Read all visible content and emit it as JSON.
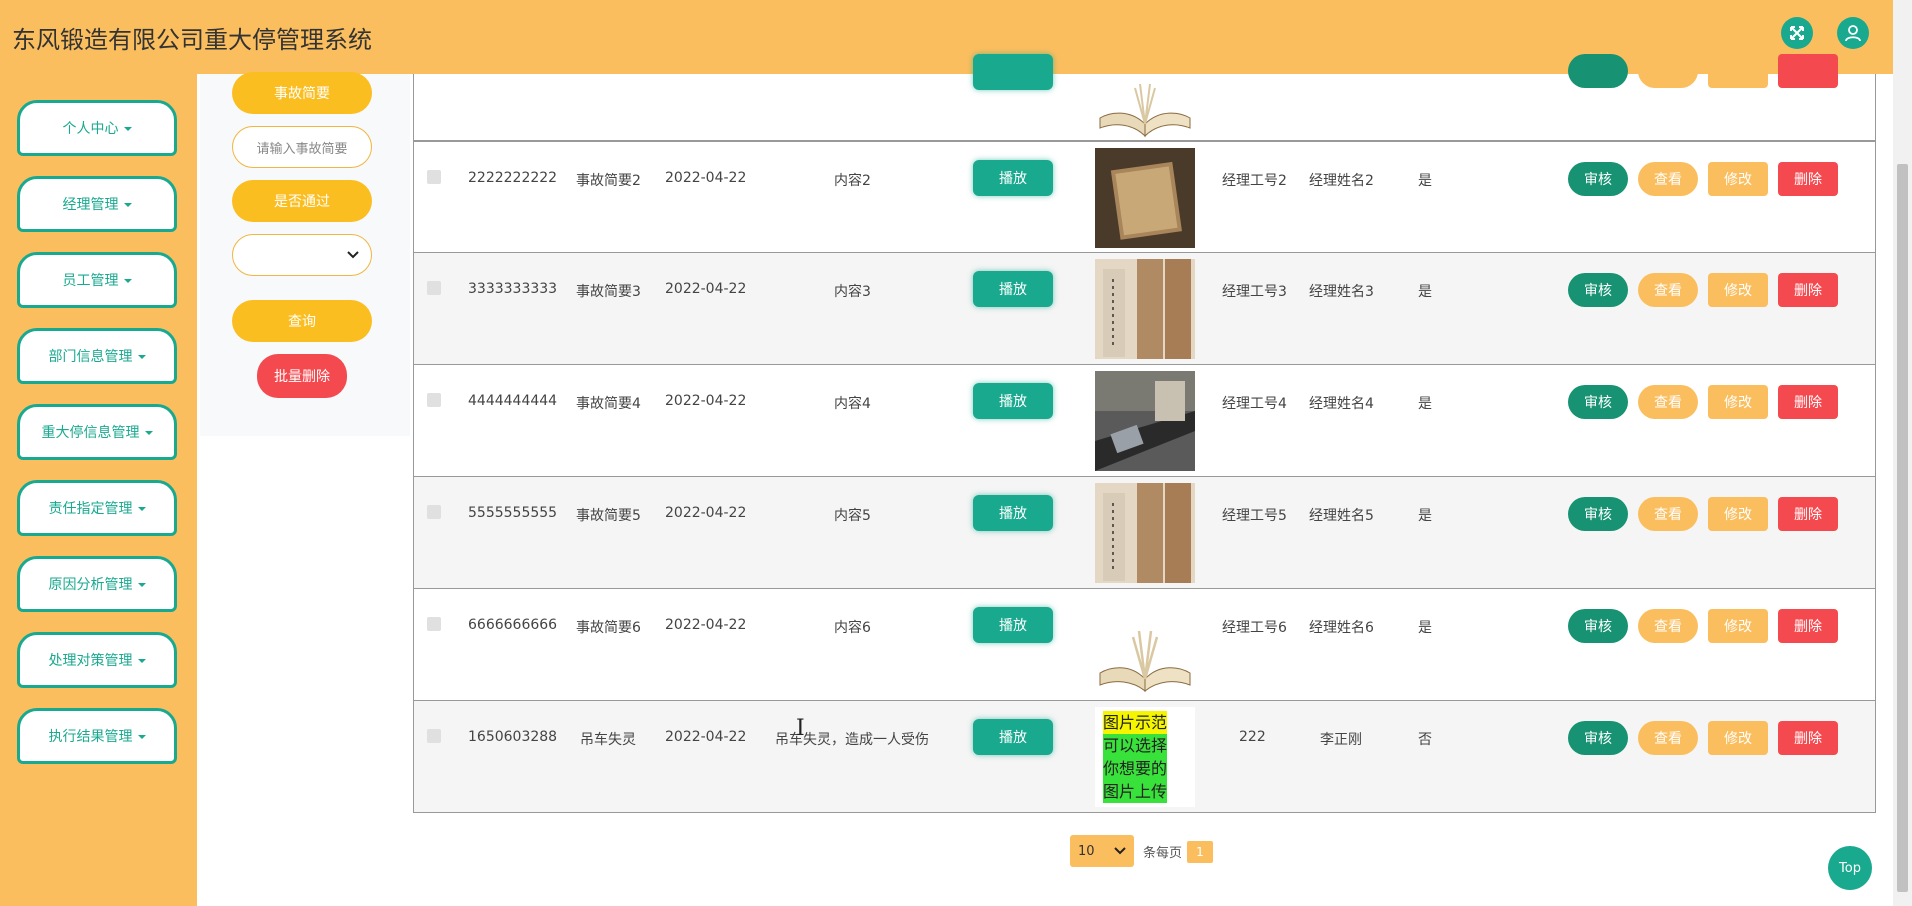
{
  "header": {
    "title": "东风锻造有限公司重大停管理系统"
  },
  "sidebar": {
    "items": [
      {
        "label": "个人中心"
      },
      {
        "label": "经理管理"
      },
      {
        "label": "员工管理"
      },
      {
        "label": "部门信息管理"
      },
      {
        "label": "重大停信息管理"
      },
      {
        "label": "责任指定管理"
      },
      {
        "label": "原因分析管理"
      },
      {
        "label": "处理对策管理"
      },
      {
        "label": "执行结果管理"
      }
    ]
  },
  "search": {
    "summary_label": "事故简要",
    "summary_placeholder": "请输入事故简要",
    "passed_label": "是否通过",
    "query_label": "查询",
    "batch_delete_label": "批量删除"
  },
  "table": {
    "play_label": "播放",
    "actions": {
      "review": "审核",
      "view": "查看",
      "edit": "修改",
      "delete": "删除"
    },
    "rows": [
      {
        "id": "2222222222",
        "summary": "事故简要2",
        "date": "2022-04-22",
        "content": "内容2",
        "image": "old-book",
        "manager_no": "经理工号2",
        "manager_name": "经理姓名2",
        "passed": "是"
      },
      {
        "id": "3333333333",
        "summary": "事故简要3",
        "date": "2022-04-22",
        "content": "内容3",
        "image": "scrolls",
        "manager_no": "经理工号3",
        "manager_name": "经理姓名3",
        "passed": "是"
      },
      {
        "id": "4444444444",
        "summary": "事故简要4",
        "date": "2022-04-22",
        "content": "内容4",
        "image": "library",
        "manager_no": "经理工号4",
        "manager_name": "经理姓名4",
        "passed": "是"
      },
      {
        "id": "5555555555",
        "summary": "事故简要5",
        "date": "2022-04-22",
        "content": "内容5",
        "image": "scrolls",
        "manager_no": "经理工号5",
        "manager_name": "经理姓名5",
        "passed": "是"
      },
      {
        "id": "6666666666",
        "summary": "事故简要6",
        "date": "2022-04-22",
        "content": "内容6",
        "image": "open-book",
        "manager_no": "经理工号6",
        "manager_name": "经理姓名6",
        "passed": "是"
      },
      {
        "id": "1650603288",
        "summary": "吊车失灵",
        "date": "2022-04-22",
        "content": "吊车失灵，造成一人受伤",
        "image": "sample-text",
        "manager_no": "222",
        "manager_name": "李正刚",
        "passed": "否"
      }
    ],
    "sample_image_lines": [
      "图片示范",
      "可以选择",
      "你想要的",
      "图片上传"
    ]
  },
  "pagination": {
    "page_size": "10",
    "per_page_label": "条每页",
    "current_page": "1"
  },
  "top_button": "Top"
}
